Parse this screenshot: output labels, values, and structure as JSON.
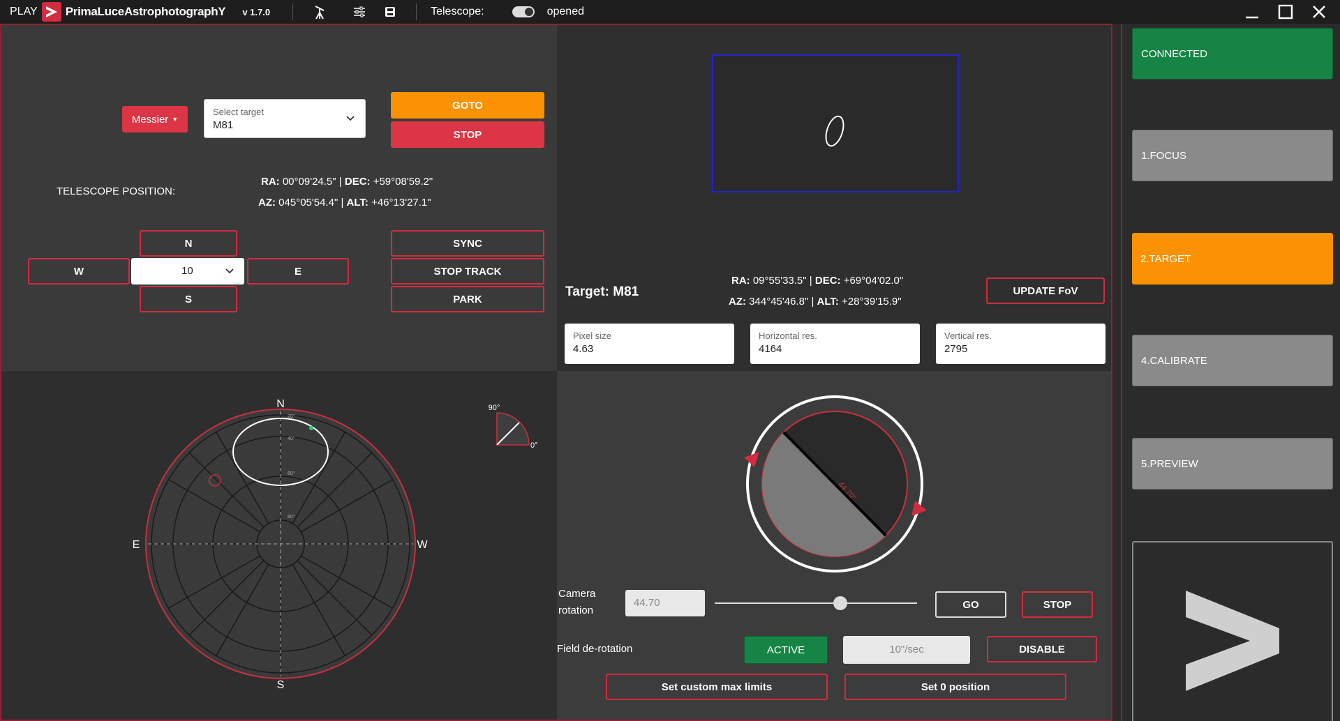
{
  "titlebar": {
    "play": "PLAY",
    "brand": "PrimaLuceAstrophotographY",
    "version": "v 1.7.0",
    "telescope_label": "Telescope:",
    "telescope_status": "opened"
  },
  "goto_panel": {
    "catalog_button": "Messier",
    "target_select": {
      "label": "Select target",
      "value": "M81"
    },
    "goto_button": "GOTO",
    "stop_button": "STOP",
    "telescope_position_label": "TELESCOPE POSITION:",
    "position": {
      "ra_label": "RA:",
      "ra": "00°09'24.5\"",
      "dec_label": "DEC:",
      "dec": "+59°08'59.2\"",
      "az_label": "AZ:",
      "az": "045°05'54.4\"",
      "alt_label": "ALT:",
      "alt": "+46°13'27.1\""
    },
    "nav": {
      "n": "N",
      "s": "S",
      "e": "E",
      "w": "W",
      "speed": "10"
    },
    "sync_button": "SYNC",
    "stop_track_button": "STOP TRACK",
    "park_button": "PARK"
  },
  "fov_panel": {
    "target_title": "Target: M81",
    "target_coords": {
      "ra_label": "RA:",
      "ra": "09°55'33.5\"",
      "dec_label": "DEC:",
      "dec": "+69°04'02.0\"",
      "az_label": "AZ:",
      "az": "344°45'46.8\"",
      "alt_label": "ALT:",
      "alt": "+28°39'15.9\""
    },
    "update_fov_button": "UPDATE FoV",
    "pixel_size": {
      "label": "Pixel size",
      "value": "4.63"
    },
    "horizontal_res": {
      "label": "Horizontal res.",
      "value": "4164"
    },
    "vertical_res": {
      "label": "Vertical res.",
      "value": "2795"
    }
  },
  "sky_map": {
    "north": "N",
    "south": "S",
    "east": "E",
    "west": "W",
    "alt_rings": [
      "20°",
      "40°",
      "60°",
      "80°"
    ],
    "alt_indicator": {
      "top": "90°",
      "bottom": "0°"
    }
  },
  "rotator": {
    "angle_label": "44.70°",
    "angle_deg": 44.7,
    "camera_rotation_label": "Camera rotation",
    "camera_rotation_value": "44.70",
    "slider_fraction": 0.62,
    "go_button": "GO",
    "stop_button": "STOP",
    "field_derotation_label": "Field de-rotation",
    "active_button": "ACTIVE",
    "derotation_rate": "10\"/sec",
    "disable_button": "DISABLE",
    "set_limits_button": "Set custom max limits",
    "set_zero_button": "Set 0 position"
  },
  "sidebar": {
    "connected": "CONNECTED",
    "focus": "1.FOCUS",
    "target": "2.TARGET",
    "calibrate": "4.CALIBRATE",
    "preview": "5.PREVIEW"
  },
  "colors": {
    "accent_red": "#dc3545",
    "accent_orange": "#fb9203",
    "accent_green": "#168445",
    "sidebar_grey": "#8a8a8a"
  }
}
